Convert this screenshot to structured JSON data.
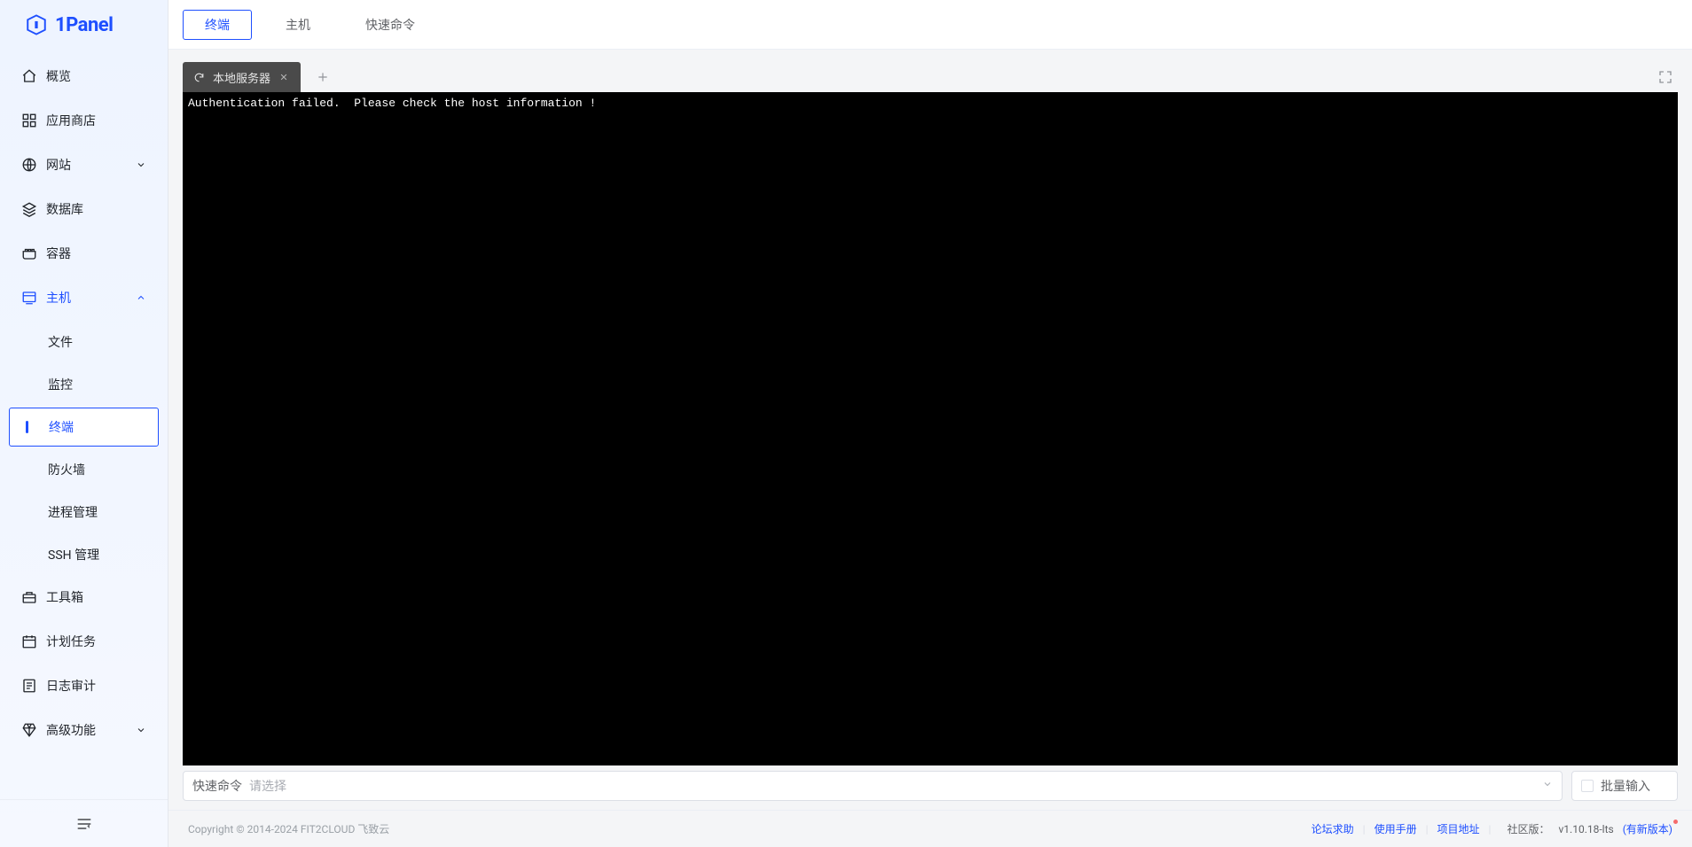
{
  "brand": {
    "name": "1Panel"
  },
  "sidebar": {
    "items": [
      {
        "label": "概览",
        "icon": "home"
      },
      {
        "label": "应用商店",
        "icon": "apps"
      },
      {
        "label": "网站",
        "icon": "globe",
        "expandable": true
      },
      {
        "label": "数据库",
        "icon": "layers"
      },
      {
        "label": "容器",
        "icon": "container"
      },
      {
        "label": "主机",
        "icon": "host",
        "expandable": true,
        "expanded": true,
        "activeParent": true,
        "children": [
          {
            "label": "文件"
          },
          {
            "label": "监控"
          },
          {
            "label": "终端",
            "active": true
          },
          {
            "label": "防火墙"
          },
          {
            "label": "进程管理"
          },
          {
            "label": "SSH 管理"
          }
        ]
      },
      {
        "label": "工具箱",
        "icon": "toolbox"
      },
      {
        "label": "计划任务",
        "icon": "calendar"
      },
      {
        "label": "日志审计",
        "icon": "log"
      },
      {
        "label": "高级功能",
        "icon": "diamond",
        "expandable": true
      }
    ]
  },
  "topTabs": [
    {
      "label": "终端",
      "active": true
    },
    {
      "label": "主机"
    },
    {
      "label": "快速命令"
    }
  ],
  "terminalTabs": [
    {
      "label": "本地服务器"
    }
  ],
  "terminalOutput": "Authentication failed.  Please check the host information !",
  "quickCmd": {
    "label": "快速命令",
    "placeholder": "请选择"
  },
  "batchInput": {
    "label": "批量输入"
  },
  "footer": {
    "copyright": "Copyright © 2014-2024 FIT2CLOUD 飞致云",
    "links": [
      {
        "label": "论坛求助"
      },
      {
        "label": "使用手册"
      },
      {
        "label": "项目地址"
      }
    ],
    "versionLabel": "社区版：",
    "version": "v1.10.18-lts",
    "newVersion": "(有新版本)"
  }
}
